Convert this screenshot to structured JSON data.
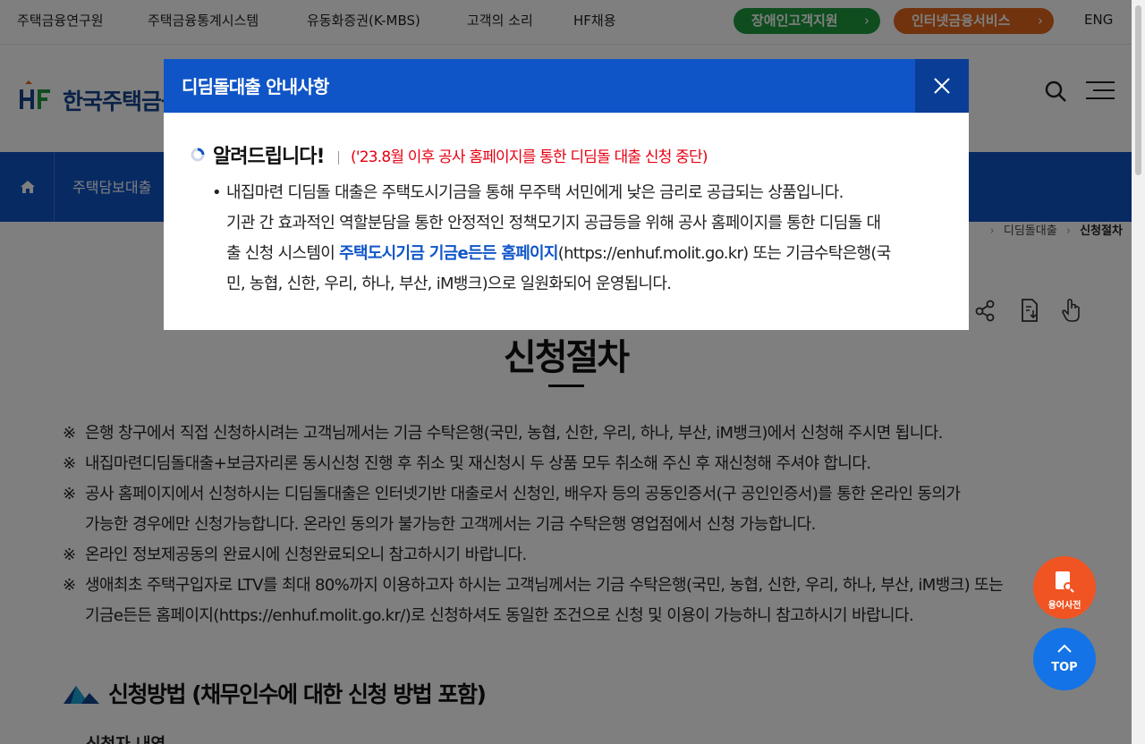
{
  "topbar": {
    "links": [
      "주택금융연구원",
      "주택금융통계시스템",
      "유동화증권(K-MBS)",
      "고객의 소리",
      "HF채용"
    ],
    "disability_support": "장애인고객지원",
    "internet_service": "인터넷금융서비스",
    "lang": "ENG"
  },
  "header": {
    "logo_text": "한국주택금융공사"
  },
  "nav": {
    "first_item": "주택담보대출"
  },
  "breadcrumb": {
    "parent": "디딤돌대출",
    "current": "신청절차"
  },
  "page": {
    "title": "신청절차",
    "notes": [
      "은행 창구에서 직접 신청하시려는 고객님께서는 기금 수탁은행(국민, 농협, 신한, 우리, 하나, 부산, iM뱅크)에서 신청해 주시면 됩니다.",
      "내집마련디딤돌대출+보금자리론 동시신청 진행 후 취소 및 재신청시 두 상품 모두 취소해 주신 후 재신청해 주셔야 합니다.",
      "공사 홈페이지에서 신청하시는 디딤돌대출은 인터넷기반 대출로서 신청인, 배우자 등의 공동인증서(구 공인인증서)를 통한 온라인 동의가",
      "가능한 경우에만 신청가능합니다. 온라인 동의가 불가능한 고객께서는 기금 수탁은행 영업점에서 신청 가능합니다.",
      "온라인 정보제공동의 완료시에 신청완료되오니 참고하시기 바랍니다.",
      "생애최초 주택구입자로 LTV를 최대 80%까지 이용하고자 하시는 고객님께서는 기금 수탁은행(국민, 농협, 신한, 우리, 하나, 부산, iM뱅크) 또는",
      "기금e든든 홈페이지(https://enhuf.molit.go.kr/)로 신청하셔도 동일한 조건으로 신청 및 이용이 가능하니 참고하시기 바랍니다."
    ],
    "note_mark": "※",
    "section_title": "신청방법 (채무인수에 대한 신청 방법 포함)",
    "sub_title": "신청자 내역"
  },
  "fab": {
    "dictionary": "용어사전",
    "top": "TOP"
  },
  "modal": {
    "title": "디딤돌대출 안내사항",
    "notice_title": "알려드립니다!",
    "notice_sub": "('23.8월 이후 공사 홈페이지를 통한 디딤돌 대출 신청 중단)",
    "line1": "내집마련 디딤돌 대출은 주택도시기금을 통해 무주택 서민에게 낮은 금리로 공급되는 상품입니다.",
    "line2": "기관 간 효과적인 역할분담을 통한 안정적인 정책모기지 공급등을 위해 공사 홈페이지를 통한 디딤돌 대",
    "line3_pre": "출 신청 시스템이 ",
    "line3_link": "주택도시기금 기금e든든 홈페이지",
    "line3_post": "(https://enhuf.molit.go.kr) 또는 기금수탁은행(국",
    "line4": "민, 농협, 신한, 우리, 하나, 부산, iM뱅크)으로 일원화되어 운영됩니다."
  },
  "colors": {
    "primary": "#0f55c7",
    "green": "#1f9a3e",
    "orange": "#e0661c",
    "alert": "#e60012"
  }
}
